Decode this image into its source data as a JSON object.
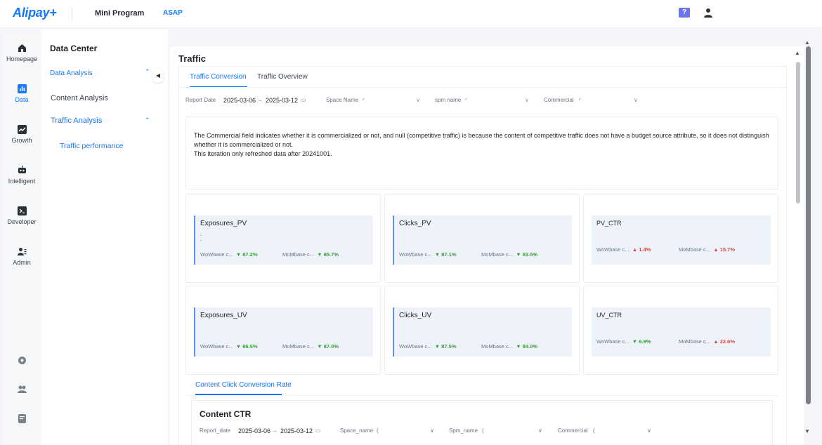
{
  "topbar": {
    "logo": "Alipay+",
    "mini_program": "Mini Program",
    "asap": "ASAP",
    "help_icon": "help-icon",
    "user_icon": "user-icon"
  },
  "rail": {
    "items": [
      {
        "label": "Homepage",
        "icon": "home-icon"
      },
      {
        "label": "Data",
        "icon": "chart-bar-icon"
      },
      {
        "label": "Growth",
        "icon": "growth-chart-icon"
      },
      {
        "label": "Intelligent",
        "icon": "robot-icon"
      },
      {
        "label": "Developer",
        "icon": "terminal-icon"
      },
      {
        "label": "Admin",
        "icon": "admin-users-icon"
      }
    ],
    "bottom_icons": [
      "settings-icon",
      "people-icon",
      "document-icon"
    ]
  },
  "subnav": {
    "title": "Data Center",
    "data_analysis": "Data Analysis",
    "content_analysis": "Content Analysis",
    "traffic_analysis": "Traffic Analysis",
    "traffic_performance": "Traffic performance"
  },
  "main": {
    "title": "Traffic",
    "tabs": [
      {
        "label": "Traffic Conversion"
      },
      {
        "label": "Traffic Overview"
      }
    ],
    "filters": {
      "report_date_label": "Report Date",
      "start_date": "2025-03-06",
      "separator": "→",
      "end_date": "2025-03-12",
      "space_name_label": "Space Name",
      "spm_name_label": "spm name",
      "commercial_label": "Commercial"
    },
    "notice": {
      "line1": "The Commercial field indicates whether it is commercialized or not, and null (competitive traffic) is because the content of competitive traffic does not have a budget source attribute, so it does not distinguish whether it is commercialized or not.",
      "line2": "This iteration only refreshed data after 20241001."
    },
    "cards": [
      {
        "title": "Exposures_PV",
        "wow_label": "WoWbase c...",
        "wow_value": "87.2%",
        "mom_label": "MoMbase c...",
        "mom_value": "85.7%"
      },
      {
        "title": "Clicks_PV",
        "wow_label": "WoWbase c...",
        "wow_value": "87.1%",
        "mom_label": "MoMbase c...",
        "mom_value": "83.5%"
      },
      {
        "title": "PV_CTR",
        "wow_label": "WoWbase c...",
        "wow_value": "1.4%",
        "mom_label": "MoMbase c...",
        "mom_value": "15.7%"
      },
      {
        "title": "Exposures_UV",
        "wow_label": "WoWbase c...",
        "wow_value": "86.5%",
        "mom_label": "MoMbase c...",
        "mom_value": "87.0%"
      },
      {
        "title": "Clicks_UV",
        "wow_label": "WoWbase c...",
        "wow_value": "87.5%",
        "mom_label": "MoMbase c...",
        "mom_value": "84.0%"
      },
      {
        "title": "UV_CTR",
        "wow_label": "WoWbase c...",
        "wow_value": "6.9%",
        "mom_label": "MoMbase c...",
        "mom_value": "22.6%"
      }
    ],
    "section2": {
      "tab": "Content Click Conversion Rate",
      "title": "Content CTR",
      "report_date_label": "Report_date",
      "start_date": "2025-03-06",
      "separator": "→",
      "end_date": "2025-03-12",
      "space_name_label": "Space_name",
      "spm_name_label": "Spm_name",
      "commercial_label": "Commercial"
    }
  },
  "colors": {
    "accent": "#1677ff",
    "down": "#3aa037",
    "up": "#e8463b",
    "card_bg": "#eef3fb"
  }
}
